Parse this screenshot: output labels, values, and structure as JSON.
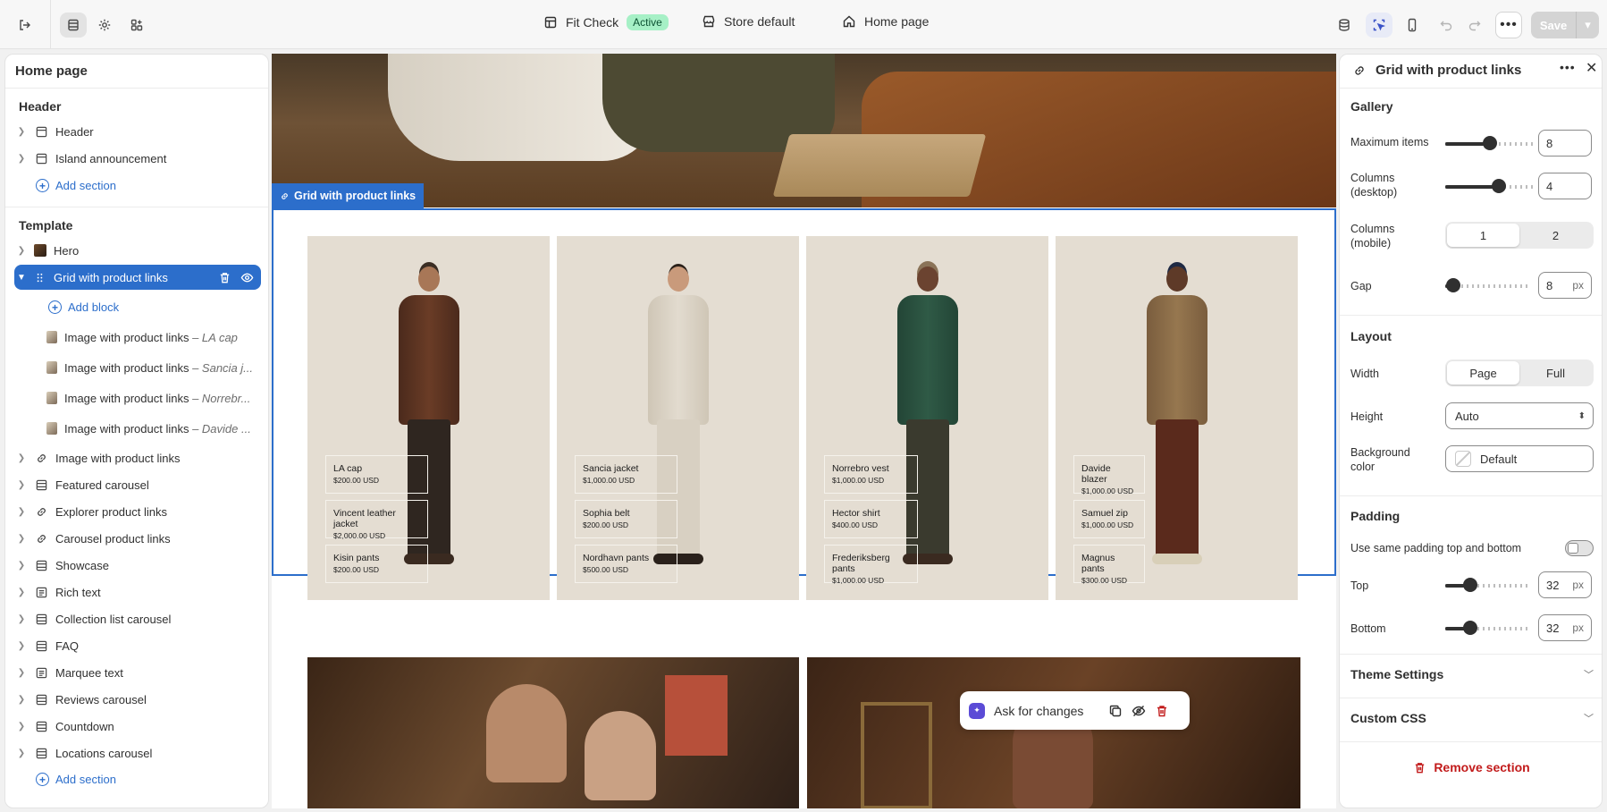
{
  "topbar": {
    "fit_check": "Fit Check",
    "fit_status": "Active",
    "store": "Store default",
    "page": "Home page",
    "save": "Save"
  },
  "left": {
    "title": "Home page",
    "header_group": "Header",
    "header_items": [
      "Header",
      "Island announcement"
    ],
    "add_section": "Add section",
    "template_group": "Template",
    "hero": "Hero",
    "selected": "Grid with product links",
    "add_block": "Add block",
    "blocks": [
      {
        "label": "Image with product links",
        "sub": "– LA cap"
      },
      {
        "label": "Image with product links",
        "sub": "– Sancia j..."
      },
      {
        "label": "Image with product links",
        "sub": "– Norrebr..."
      },
      {
        "label": "Image with product links",
        "sub": "– Davide ..."
      }
    ],
    "sections": [
      "Image with product links",
      "Featured carousel",
      "Explorer product links",
      "Carousel product links",
      "Showcase",
      "Rich text",
      "Collection list carousel",
      "FAQ",
      "Marquee text",
      "Reviews carousel",
      "Countdown",
      "Locations carousel"
    ],
    "add_section_2": "Add section"
  },
  "canvas": {
    "tag": "Grid with product links",
    "cards": [
      {
        "products": [
          {
            "name": "LA cap",
            "price": "$200.00 USD"
          },
          {
            "name": "Vincent leather jacket",
            "price": "$2,000.00 USD"
          },
          {
            "name": "Kisin pants",
            "price": "$200.00 USD"
          }
        ]
      },
      {
        "products": [
          {
            "name": "Sancia jacket",
            "price": "$1,000.00 USD"
          },
          {
            "name": "Sophia belt",
            "price": "$200.00 USD"
          },
          {
            "name": "Nordhavn pants",
            "price": "$500.00 USD"
          }
        ]
      },
      {
        "products": [
          {
            "name": "Norrebro vest",
            "price": "$1,000.00 USD"
          },
          {
            "name": "Hector shirt",
            "price": "$400.00 USD"
          },
          {
            "name": "Frederiksberg pants",
            "price": "$1,000.00 USD"
          }
        ]
      },
      {
        "products": [
          {
            "name": "Davide blazer",
            "price": "$1,000.00 USD"
          },
          {
            "name": "Samuel zip",
            "price": "$1,000.00 USD"
          },
          {
            "name": "Magnus pants",
            "price": "$300.00 USD"
          }
        ]
      }
    ],
    "ask": "Ask for changes"
  },
  "settings": {
    "title": "Grid with product links",
    "gallery": "Gallery",
    "max_items_label": "Maximum items",
    "max_items": "8",
    "max_items_level": 0.5,
    "cols_desktop_label": "Columns (desktop)",
    "cols_desktop": "4",
    "cols_desktop_level": 0.6,
    "cols_mobile_label": "Columns (mobile)",
    "cols_mobile_options": [
      "1",
      "2"
    ],
    "gap_label": "Gap",
    "gap": "8",
    "gap_unit": "px",
    "gap_level": 0.1,
    "layout": "Layout",
    "width_label": "Width",
    "width_options": [
      "Page",
      "Full"
    ],
    "height_label": "Height",
    "height_value": "Auto",
    "bg_label": "Background color",
    "bg_value": "Default",
    "padding": "Padding",
    "same_padding_label": "Use same padding top and bottom",
    "top_label": "Top",
    "top_value": "32",
    "top_level": 0.3,
    "bottom_label": "Bottom",
    "bottom_value": "32",
    "bottom_level": 0.3,
    "unit": "px",
    "theme_settings": "Theme Settings",
    "custom_css": "Custom CSS",
    "remove": "Remove section"
  }
}
